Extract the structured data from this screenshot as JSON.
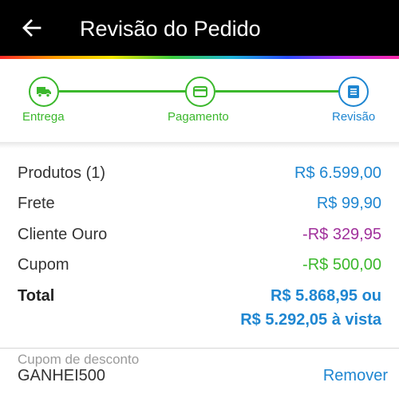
{
  "appbar": {
    "title": "Revisão do Pedido",
    "back_icon": "arrow-left-icon"
  },
  "stepper": {
    "steps": [
      {
        "label": "Entrega",
        "icon": "truck-icon",
        "status": "completed",
        "color": "#3bb82c"
      },
      {
        "label": "Pagamento",
        "icon": "credit-card-icon",
        "status": "completed",
        "color": "#3bb82c"
      },
      {
        "label": "Revisão",
        "icon": "receipt-icon",
        "status": "current",
        "color": "#1e86d1"
      }
    ]
  },
  "summary": {
    "rows": [
      {
        "label": "Produtos (1)",
        "value": "R$ 6.599,00",
        "color": "#1e86d1"
      },
      {
        "label": "Frete",
        "value": "R$ 99,90",
        "color": "#1e86d1"
      },
      {
        "label": "Cliente Ouro",
        "value": "-R$ 329,95",
        "color": "#a0309b"
      },
      {
        "label": "Cupom",
        "value": "-R$ 500,00",
        "color": "#3bb82c"
      }
    ],
    "total": {
      "label": "Total",
      "value_line1": "R$ 5.868,95 ou",
      "value_line2": "R$ 5.292,05 à vista"
    }
  },
  "coupon": {
    "caption": "Cupom de desconto",
    "code": "GANHEI500",
    "remove_label": "Remover"
  },
  "colors": {
    "accent_blue": "#1e86d1",
    "success_green": "#3bb82c",
    "gold_purple": "#a0309b",
    "appbar_bg": "#000000"
  }
}
